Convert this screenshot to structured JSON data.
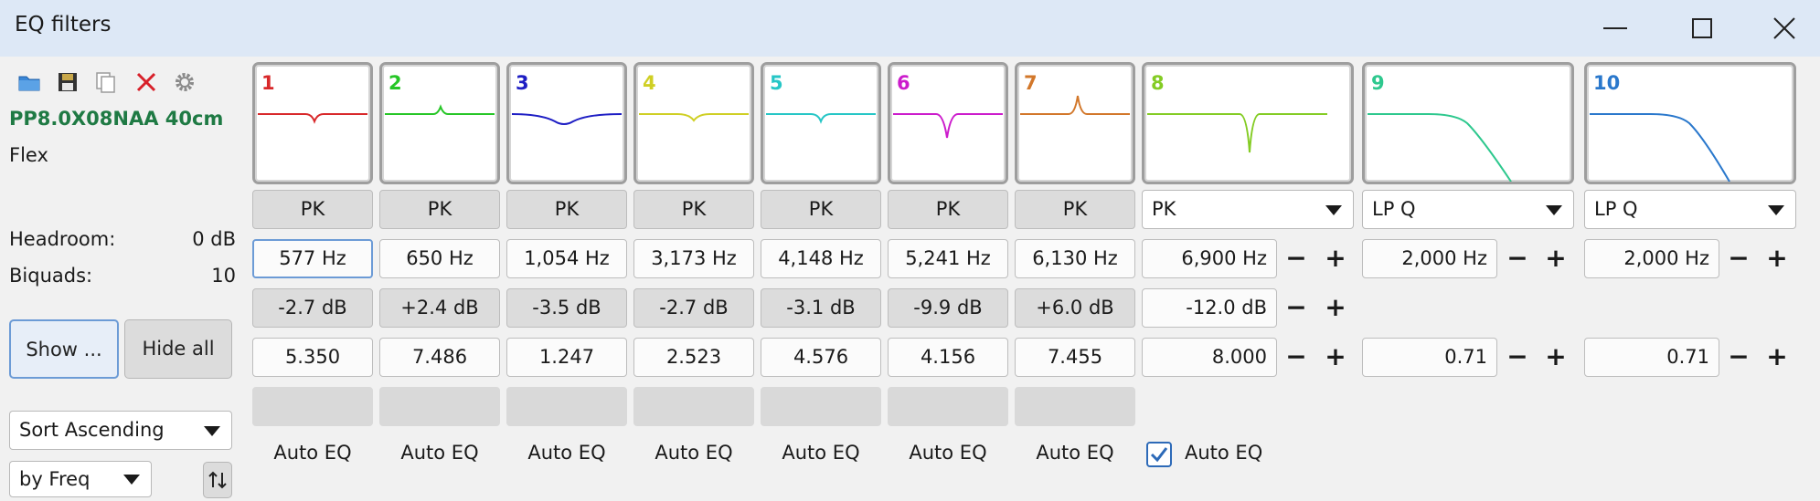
{
  "window": {
    "title": "EQ filters",
    "controls": [
      "minimize-icon",
      "maximize-icon",
      "close-icon"
    ]
  },
  "toolbar": {
    "icons": [
      "folder-icon",
      "save-icon",
      "copy-icon",
      "delete-icon",
      "gear-icon"
    ]
  },
  "driver": {
    "name": "PP8.0X08NAA 40cm",
    "mode": "Flex"
  },
  "stats": {
    "headroom_label": "Headroom:",
    "headroom_value": "0 dB",
    "biquads_label": "Biquads:",
    "biquads_value": "10"
  },
  "buttons": {
    "show": "Show ...",
    "hide_all": "Hide all"
  },
  "sort": {
    "order": "Sort Ascending",
    "by": "by Freq",
    "sort_icon": "swap-vertical-icon"
  },
  "colors": {
    "1": "#d8282a",
    "2": "#27c627",
    "3": "#1e1ec4",
    "4": "#cfcf24",
    "5": "#26c6c6",
    "6": "#cc1ccc",
    "7": "#d2772a",
    "8": "#84cc24",
    "9": "#2ec88e",
    "10": "#2a78cc"
  },
  "filters": [
    {
      "num": "1",
      "type": "PK",
      "freq": "577 Hz",
      "gain": "-2.7 dB",
      "q": "5.350",
      "auto": "Auto EQ"
    },
    {
      "num": "2",
      "type": "PK",
      "freq": "650 Hz",
      "gain": "+2.4 dB",
      "q": "7.486",
      "auto": "Auto EQ"
    },
    {
      "num": "3",
      "type": "PK",
      "freq": "1,054 Hz",
      "gain": "-3.5 dB",
      "q": "1.247",
      "auto": "Auto EQ"
    },
    {
      "num": "4",
      "type": "PK",
      "freq": "3,173 Hz",
      "gain": "-2.7 dB",
      "q": "2.523",
      "auto": "Auto EQ"
    },
    {
      "num": "5",
      "type": "PK",
      "freq": "4,148 Hz",
      "gain": "-3.1 dB",
      "q": "4.576",
      "auto": "Auto EQ"
    },
    {
      "num": "6",
      "type": "PK",
      "freq": "5,241 Hz",
      "gain": "-9.9 dB",
      "q": "4.156",
      "auto": "Auto EQ"
    },
    {
      "num": "7",
      "type": "PK",
      "freq": "6,130 Hz",
      "gain": "+6.0 dB",
      "q": "7.455",
      "auto": "Auto EQ"
    },
    {
      "num": "8",
      "type": "PK",
      "freq": "6,900 Hz",
      "gain": "-12.0 dB",
      "q": "8.000",
      "auto": "Auto EQ",
      "auto_checked": true
    },
    {
      "num": "9",
      "type": "LP Q",
      "freq": "2,000 Hz",
      "q": "0.71"
    },
    {
      "num": "10",
      "type": "LP Q",
      "freq": "2,000 Hz",
      "q": "0.71"
    }
  ]
}
